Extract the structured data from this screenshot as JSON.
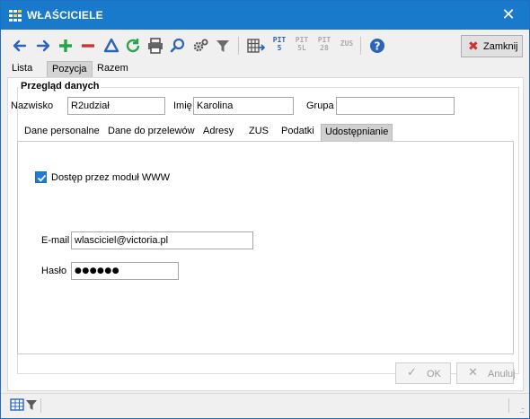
{
  "window": {
    "title": "WŁAŚCICIELE",
    "close_glyph": "✕"
  },
  "toolbar": {
    "icons": [
      "arrow-left-icon",
      "arrow-right-icon",
      "plus-icon",
      "minus-icon",
      "triangle-icon",
      "refresh-icon",
      "print-icon",
      "search-icon",
      "gear-icon",
      "filter-icon",
      "grid-export-icon",
      "pit-5-icon",
      "pit-5l-icon",
      "pit-28-icon",
      "zus-icon",
      "help-icon"
    ],
    "pit_labels": [
      {
        "top": "PIT",
        "bottom": "5"
      },
      {
        "top": "PIT",
        "bottom": "5L"
      },
      {
        "top": "PIT",
        "bottom": "28"
      },
      {
        "top": "ZUS",
        "bottom": ""
      }
    ],
    "close_label": "Zamknij"
  },
  "top_tabs": [
    "Lista",
    "Pozycja",
    "Razem"
  ],
  "overview": {
    "title": "Przegląd danych",
    "surname_label": "Nazwisko",
    "surname_value": "R2udział",
    "firstname_label": "Imię",
    "firstname_value": "Karolina",
    "group_label": "Grupa",
    "group_value": ""
  },
  "inner_tabs": [
    "Dane personalne",
    "Dane do przelewów",
    "Adresy",
    "ZUS",
    "Podatki",
    "Udostępnianie"
  ],
  "sharing": {
    "www_access_label": "Dostęp przez moduł WWW",
    "www_access_checked": true,
    "email_label": "E-mail",
    "email_value": "wlasciciel@victoria.pl",
    "password_label": "Hasło",
    "password_value": "●●●●●●"
  },
  "footer": {
    "ok_label": "OK",
    "cancel_label": "Anuluj"
  },
  "colors": {
    "titlebar": "#1979ca",
    "accent": "#1f7bd5",
    "close_x": "#d2322d",
    "green": "#2aa44a",
    "red": "#d2322d"
  }
}
